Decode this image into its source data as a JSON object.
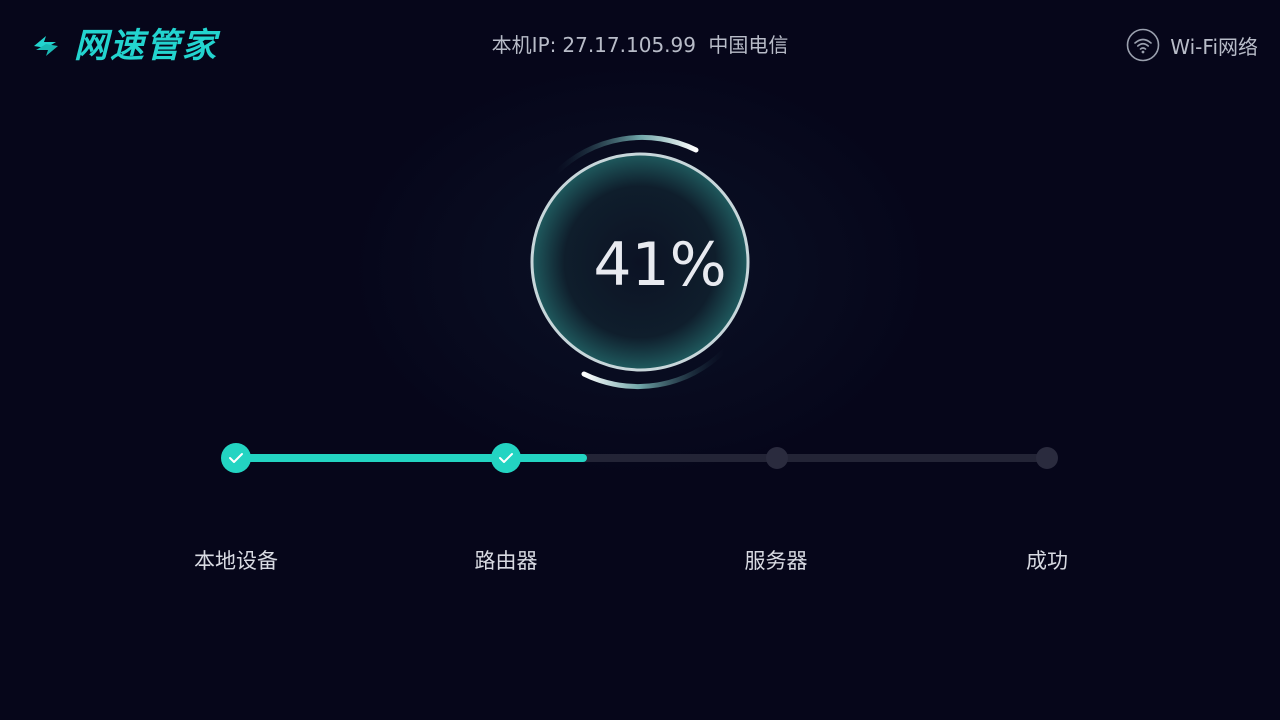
{
  "app": {
    "name": "网速管家",
    "accent_color": "#23d4cf"
  },
  "header": {
    "ip_label": "本机IP:",
    "ip_address": "27.17.105.99",
    "isp": "中国电信",
    "network_icon": "wifi-icon",
    "network_type": "Wi-Fi网络"
  },
  "progress": {
    "percent_text": "41%",
    "percent_value": 41
  },
  "steps": [
    {
      "label": "本地设备",
      "status": "done"
    },
    {
      "label": "路由器",
      "status": "done"
    },
    {
      "label": "服务器",
      "status": "pending"
    },
    {
      "label": "成功",
      "status": "pending"
    }
  ]
}
